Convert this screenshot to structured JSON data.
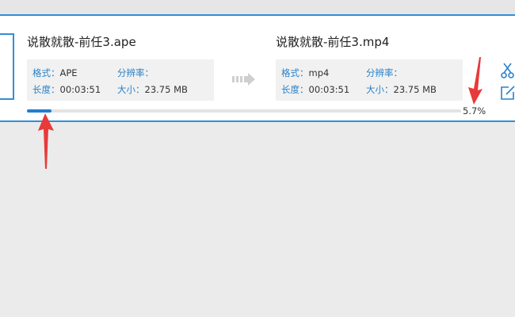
{
  "source": {
    "filename": "说散就散-前任3.ape",
    "format_label": "格式：",
    "format_value": "APE",
    "resolution_label": "分辨率：",
    "resolution_value": "",
    "duration_label": "长度：",
    "duration_value": "00:03:51",
    "size_label": "大小：",
    "size_value": "23.75 MB"
  },
  "output": {
    "filename": "说散就散-前任3.mp4",
    "format_label": "格式：",
    "format_value": "mp4",
    "resolution_label": "分辨率：",
    "resolution_value": "",
    "duration_label": "长度：",
    "duration_value": "00:03:51",
    "size_label": "大小：",
    "size_value": "23.75 MB"
  },
  "progress": {
    "text": "5.7%",
    "fraction": 0.057
  },
  "icons": {
    "convert": "convert-arrow-icon",
    "cut": "scissors-icon",
    "edit": "edit-icon"
  },
  "colors": {
    "accent": "#2f8fd8",
    "progress_fill": "#1e7fd1",
    "label": "#2a82c9",
    "annotation": "#e83a3a"
  }
}
